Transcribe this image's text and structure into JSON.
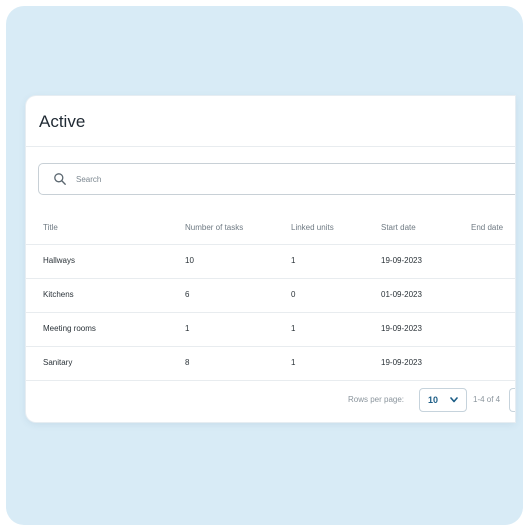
{
  "card": {
    "title": "Active"
  },
  "search": {
    "placeholder": "Search"
  },
  "table": {
    "columns": [
      "Title",
      "Number of tasks",
      "Linked units",
      "Start date",
      "End date"
    ],
    "rows": [
      [
        "Hallways",
        "10",
        "1",
        "19-09-2023",
        ""
      ],
      [
        "Kitchens",
        "6",
        "0",
        "01-09-2023",
        ""
      ],
      [
        "Meeting rooms",
        "1",
        "1",
        "19-09-2023",
        ""
      ],
      [
        "Sanitary",
        "8",
        "1",
        "19-09-2023",
        ""
      ]
    ]
  },
  "pagination": {
    "rows_per_page_label": "Rows per page:",
    "rows_per_page_value": "10",
    "range": "1-4 of 4"
  },
  "colors": {
    "backdrop": "#d8ebf6",
    "accent": "#1c5d86"
  },
  "icons": {
    "search": "search-icon",
    "select": "chevron-down-icon"
  }
}
